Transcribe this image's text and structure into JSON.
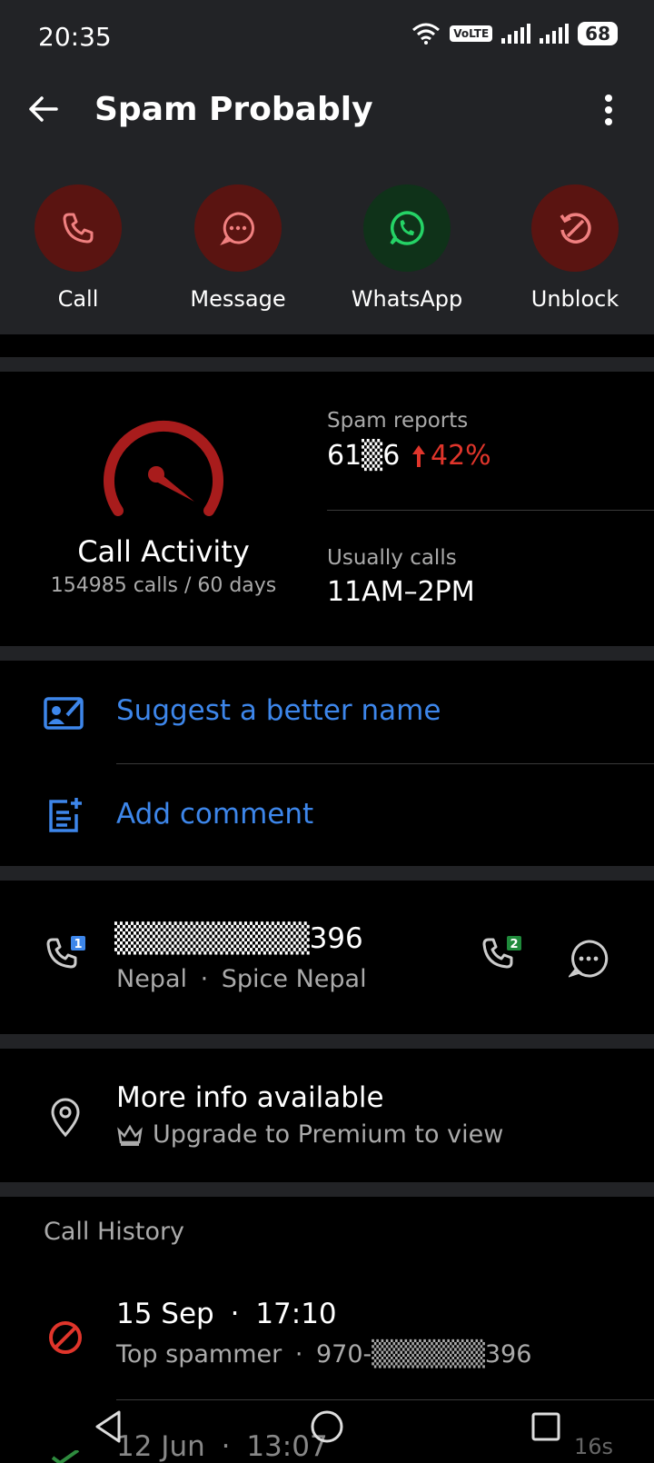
{
  "status": {
    "time": "20:35",
    "volte": "VoLTE",
    "battery": "68"
  },
  "header": {
    "title": "Spam Probably"
  },
  "actions": [
    {
      "label": "Call"
    },
    {
      "label": "Message"
    },
    {
      "label": "WhatsApp"
    },
    {
      "label": "Unblock"
    }
  ],
  "activity": {
    "title": "Call Activity",
    "subtitle": "154985 calls / 60 days",
    "spam_reports_label": "Spam reports",
    "spam_reports_value": "61▒6",
    "spam_reports_change": "42%",
    "usually_calls_label": "Usually calls",
    "usually_calls_value": "11AM–2PM"
  },
  "links": {
    "suggest": "Suggest a better name",
    "comment": "Add comment"
  },
  "number": {
    "masked": "▒▒▒▒▒▒▒▒▒396",
    "country": "Nepal",
    "carrier": "Spice Nepal",
    "sim1": "1",
    "sim2": "2"
  },
  "info": {
    "title": "More info available",
    "premium": "Upgrade to Premium to view"
  },
  "history": {
    "heading": "Call History",
    "items": [
      {
        "date": "15 Sep",
        "time": "17:10",
        "label": "Top spammer",
        "number": "970-▒▒▒▒▒▒396",
        "duration": ""
      },
      {
        "date": "12 Jun",
        "time": "13:07",
        "label": "",
        "number": "",
        "duration": "16s"
      }
    ]
  },
  "colors": {
    "accent_blue": "#3d86ea",
    "danger_red": "#e0352b",
    "whatsapp_green": "#25d366"
  }
}
